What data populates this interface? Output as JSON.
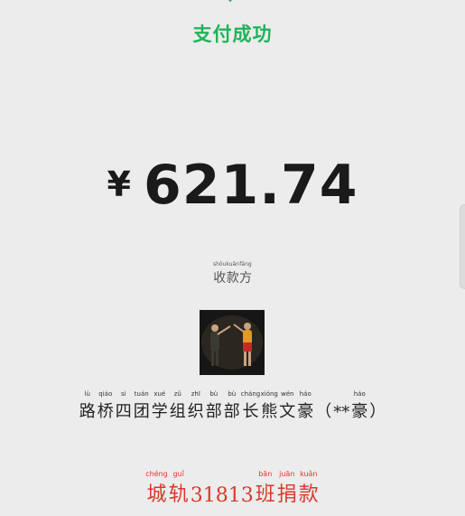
{
  "status": {
    "title": "支付成功"
  },
  "payment": {
    "currency_symbol": "¥",
    "amount": "621.74"
  },
  "payee": {
    "label_chars": [
      {
        "py": "shōu",
        "hz": "收"
      },
      {
        "py": "kuǎn",
        "hz": "款"
      },
      {
        "py": "fāng",
        "hz": "方"
      }
    ],
    "name_chars": [
      {
        "py": "lù",
        "hz": "路"
      },
      {
        "py": "qiáo",
        "hz": "桥"
      },
      {
        "py": "sì",
        "hz": "四"
      },
      {
        "py": "tuán",
        "hz": "团"
      },
      {
        "py": "xué",
        "hz": "学"
      },
      {
        "py": "zǔ",
        "hz": "组"
      },
      {
        "py": "zhī",
        "hz": "织"
      },
      {
        "py": "bù",
        "hz": "部"
      },
      {
        "py": "bù",
        "hz": "部"
      },
      {
        "py": "cháng",
        "hz": "长"
      },
      {
        "py": "xióng",
        "hz": "熊"
      },
      {
        "py": "wén",
        "hz": "文"
      },
      {
        "py": "háo",
        "hz": "豪"
      },
      {
        "py": "",
        "hz": "（"
      },
      {
        "py": "",
        "hz": "**"
      },
      {
        "py": "háo",
        "hz": "豪"
      },
      {
        "py": "",
        "hz": "）"
      }
    ]
  },
  "footer": {
    "chars": [
      {
        "py": "chéng",
        "hz": "城"
      },
      {
        "py": "guǐ",
        "hz": "轨"
      },
      {
        "py": "",
        "hz": "31813"
      },
      {
        "py": "bān",
        "hz": "班"
      },
      {
        "py": "juān",
        "hz": "捐"
      },
      {
        "py": "kuǎn",
        "hz": "款"
      }
    ]
  },
  "colors": {
    "success_green": "#20b35a",
    "footer_red": "#d8392b",
    "background": "#ececec"
  }
}
